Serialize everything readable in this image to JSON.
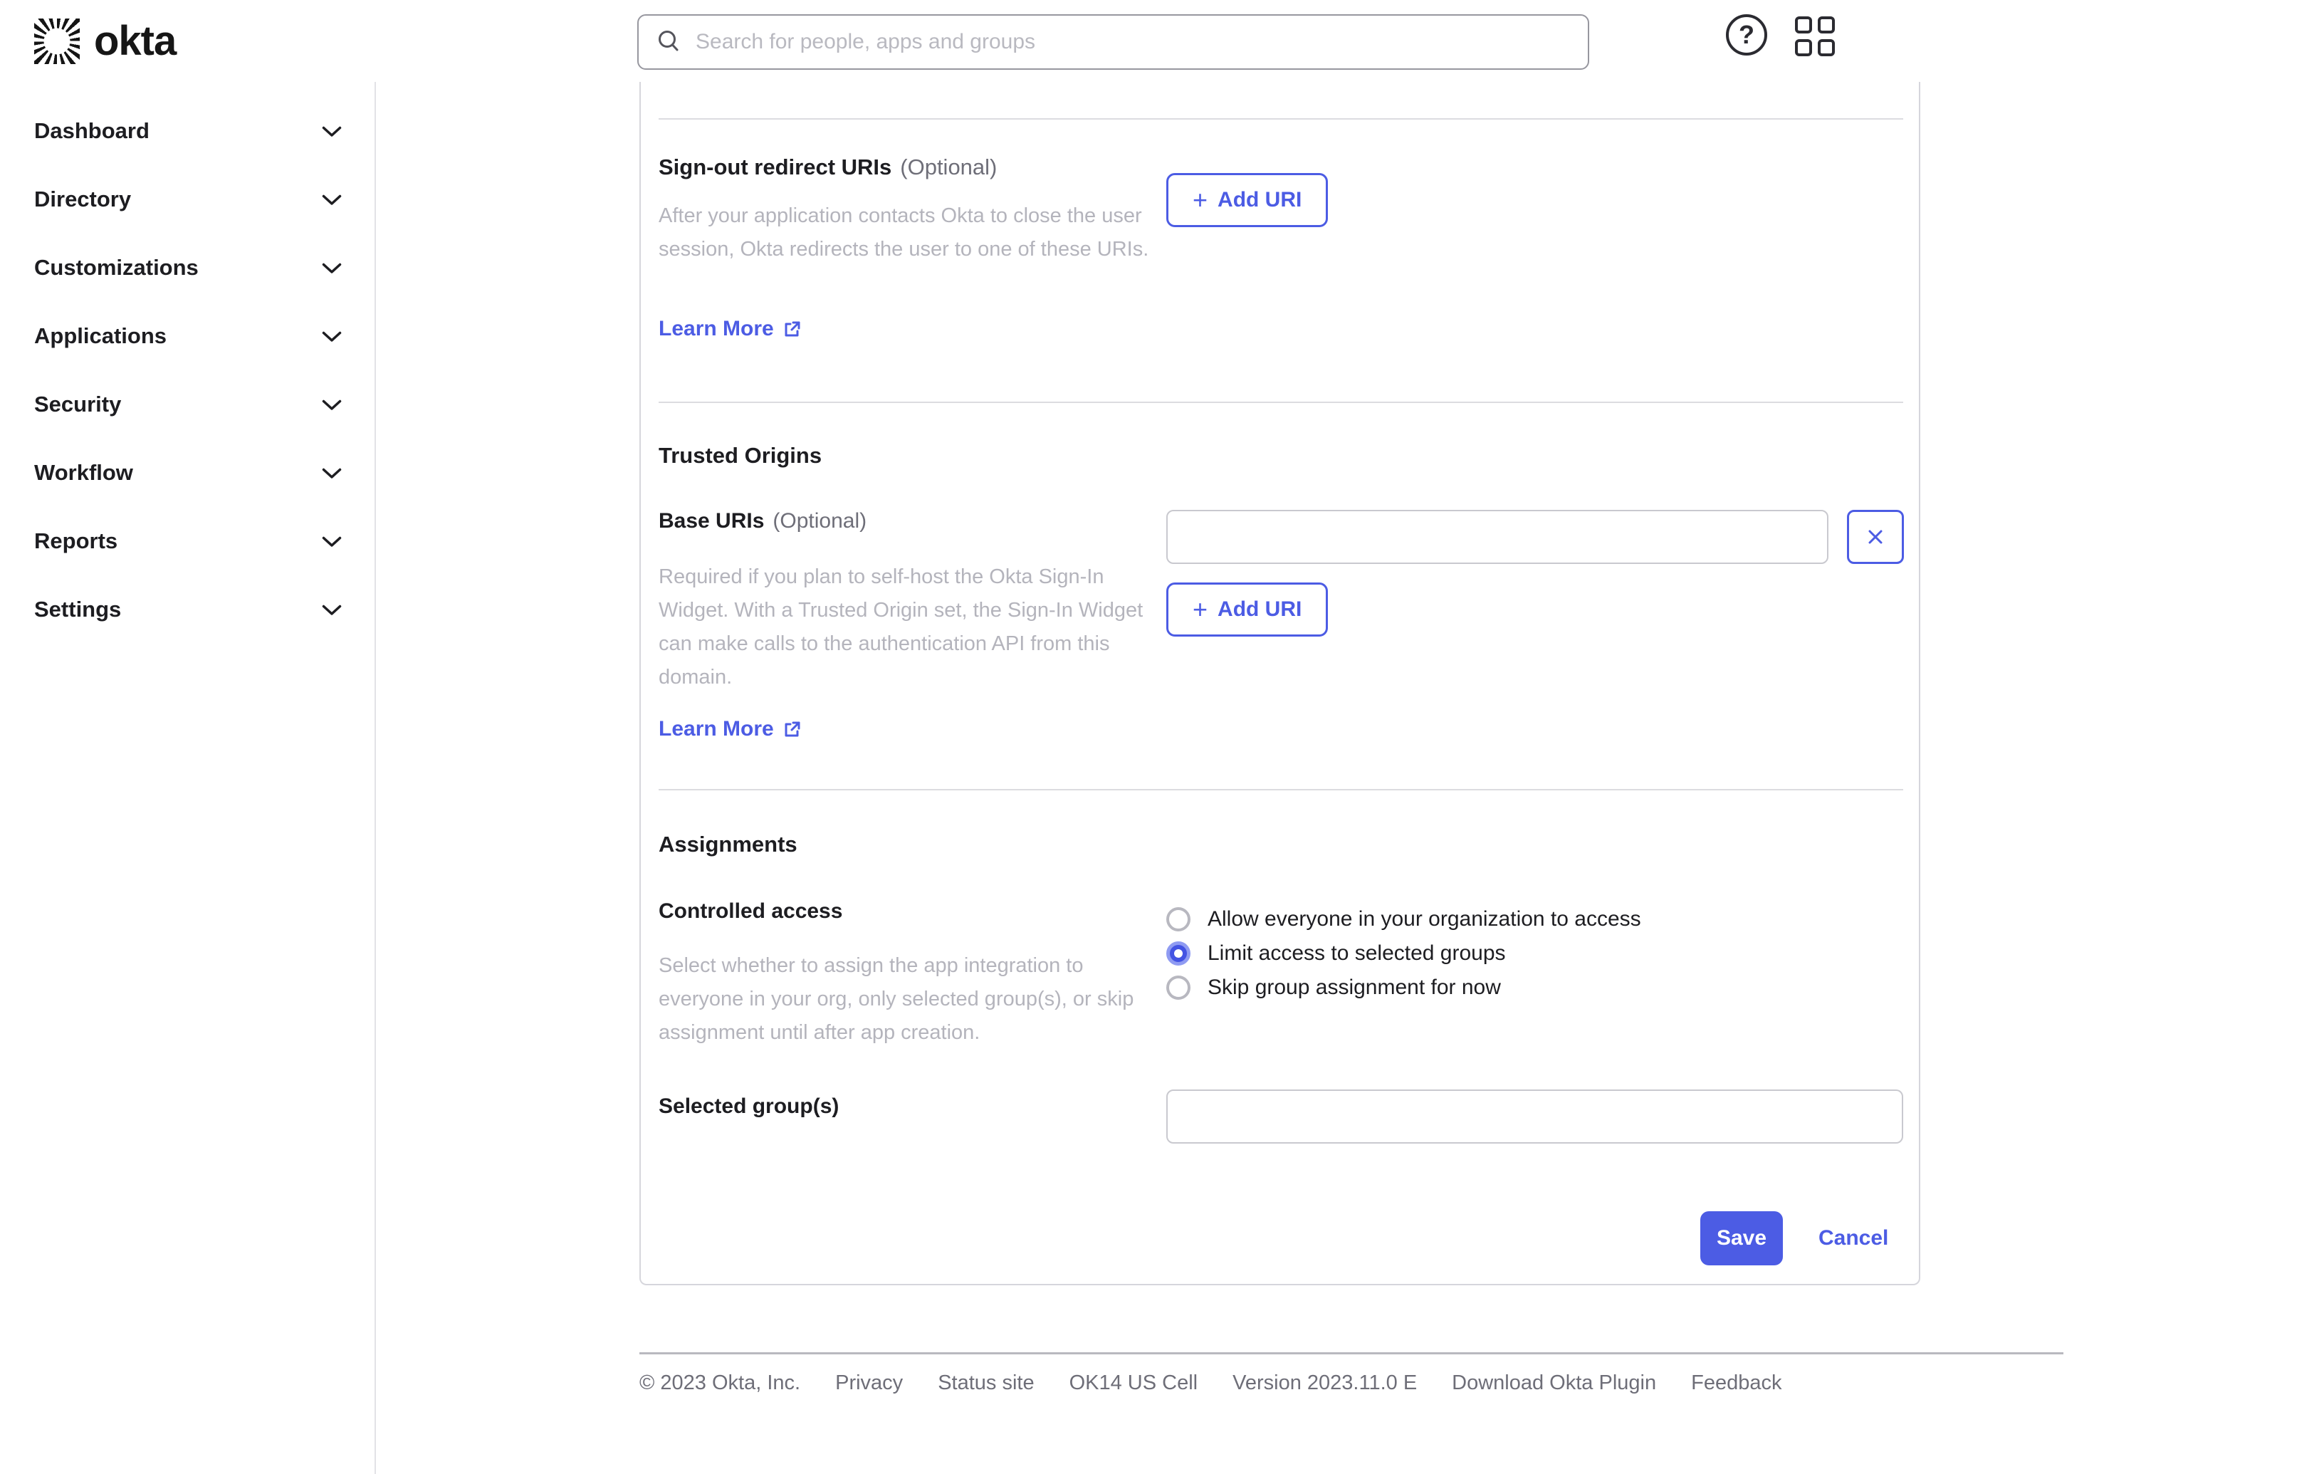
{
  "brand": {
    "wordmark": "okta"
  },
  "header": {
    "search_placeholder": "Search for people, apps and groups",
    "help_glyph": "?"
  },
  "sidebar": {
    "items": [
      {
        "label": "Dashboard"
      },
      {
        "label": "Directory"
      },
      {
        "label": "Customizations"
      },
      {
        "label": "Applications"
      },
      {
        "label": "Security"
      },
      {
        "label": "Workflow"
      },
      {
        "label": "Reports"
      },
      {
        "label": "Settings"
      }
    ]
  },
  "signout": {
    "title": "Sign-out redirect URIs",
    "optional": "(Optional)",
    "description": "After your application contacts Okta to close the user session, Okta redirects the user to one of these URIs.",
    "learn_more": "Learn More",
    "plus": "+",
    "add_uri": "Add URI"
  },
  "trusted": {
    "title": "Trusted Origins",
    "label": "Base URIs",
    "optional": "(Optional)",
    "description": "Required if you plan to self-host the Okta Sign-In Widget. With a Trusted Origin set, the Sign-In Widget can make calls to the authentication API from this domain.",
    "learn_more": "Learn More",
    "base_uri_value": "",
    "plus": "+",
    "add_uri": "Add URI"
  },
  "assignments": {
    "title": "Assignments",
    "label": "Controlled access",
    "description": "Select whether to assign the app integration to everyone in your org, only selected group(s), or skip assignment until after app creation.",
    "options": [
      {
        "label": "Allow everyone in your organization to access",
        "checked": "false"
      },
      {
        "label": "Limit access to selected groups",
        "checked": "true"
      },
      {
        "label": "Skip group assignment for now",
        "checked": "false"
      }
    ],
    "selected_groups_label": "Selected group(s)",
    "selected_groups_value": ""
  },
  "actions": {
    "save": "Save",
    "cancel": "Cancel"
  },
  "footer": {
    "items": [
      "© 2023 Okta, Inc.",
      "Privacy",
      "Status site",
      "OK14 US Cell",
      "Version 2023.11.0 E",
      "Download Okta Plugin",
      "Feedback"
    ]
  },
  "colors": {
    "accent": "#4c5ce4",
    "text": "#1d1d21",
    "muted_text": "#6e6e78",
    "description_text": "#b4b4bc",
    "border": "#d8d8dc",
    "radio_selected_ring": "#8f9bf2"
  }
}
